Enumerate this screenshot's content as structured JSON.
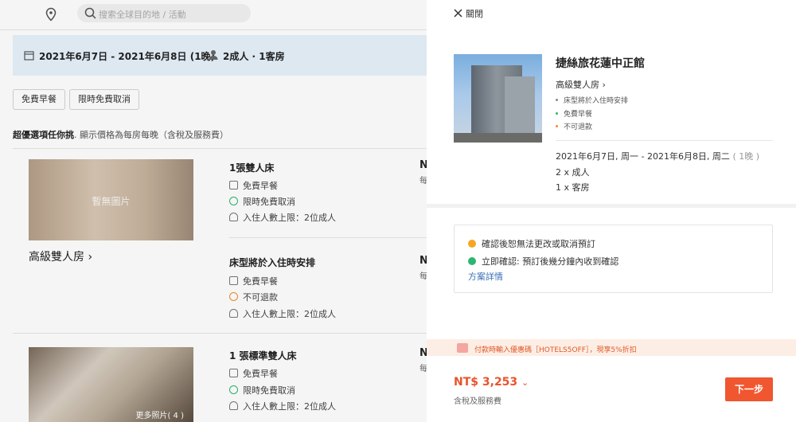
{
  "search": {
    "placeholder": "搜索全球目的地 / 活動"
  },
  "datebar": {
    "dates": "2021年6月7日 - 2021年6月8日 (1晚)",
    "guests": "2成人 · 1客房"
  },
  "filters": [
    "免費早餐",
    "限時免費取消"
  ],
  "note": {
    "bold": "超優選項任你挑",
    "rest": ". 顯示價格為每房每晚（含稅及服務費）"
  },
  "rooms": [
    {
      "name": "高級雙人房",
      "image_label": "暫無圖片",
      "options": [
        {
          "title": "1張雙人床",
          "features": [
            "免費早餐",
            "限時免費取消",
            "入住人數上限：2位成人"
          ]
        },
        {
          "title": "床型將於入住時安排",
          "features": [
            "免費早餐",
            "不可退款",
            "入住人數上限：2位成人"
          ]
        }
      ]
    },
    {
      "image_label": "更多照片( 4 )",
      "options": [
        {
          "title": "1 張標準雙人床",
          "features": [
            "免費早餐",
            "限時免費取消",
            "入住人數上限：2位成人"
          ]
        }
      ]
    }
  ],
  "price_partial": {
    "n": "N",
    "sub": "每"
  },
  "drawer": {
    "close_label": "關閉",
    "hotel_name": "捷絲旅花蓮中正館",
    "room_type": "高級雙人房",
    "room_bullets": [
      {
        "text": "床型將於入住時安排",
        "color": "#888888"
      },
      {
        "text": "免費早餐",
        "color": "#2bb673"
      },
      {
        "text": "不可退款",
        "color": "#f08c2a"
      }
    ],
    "stay_dates": "2021年6月7日, 周一 - 2021年6月8日, 周二",
    "stay_nights": "( 1晚 )",
    "adults": "2 x 成人",
    "rooms": "1 x 客房",
    "policies": [
      {
        "text": "確認後恕無法更改或取消預訂",
        "color": "#f5a623"
      },
      {
        "text": "立即確認: 預訂後幾分鐘內收到確認",
        "color": "#2bb673"
      }
    ],
    "policy_link": "方案詳情",
    "promo": "付款時輸入優惠碼［HOTELS5OFF］，現享5%折扣",
    "price": "NT$ 3,253",
    "price_note": "含稅及服務費",
    "next_button": "下一步"
  },
  "colors": {
    "accent": "#f0562f",
    "price": "#e9532b",
    "link": "#3b6fb6",
    "datebar": "#e7f2fb"
  }
}
